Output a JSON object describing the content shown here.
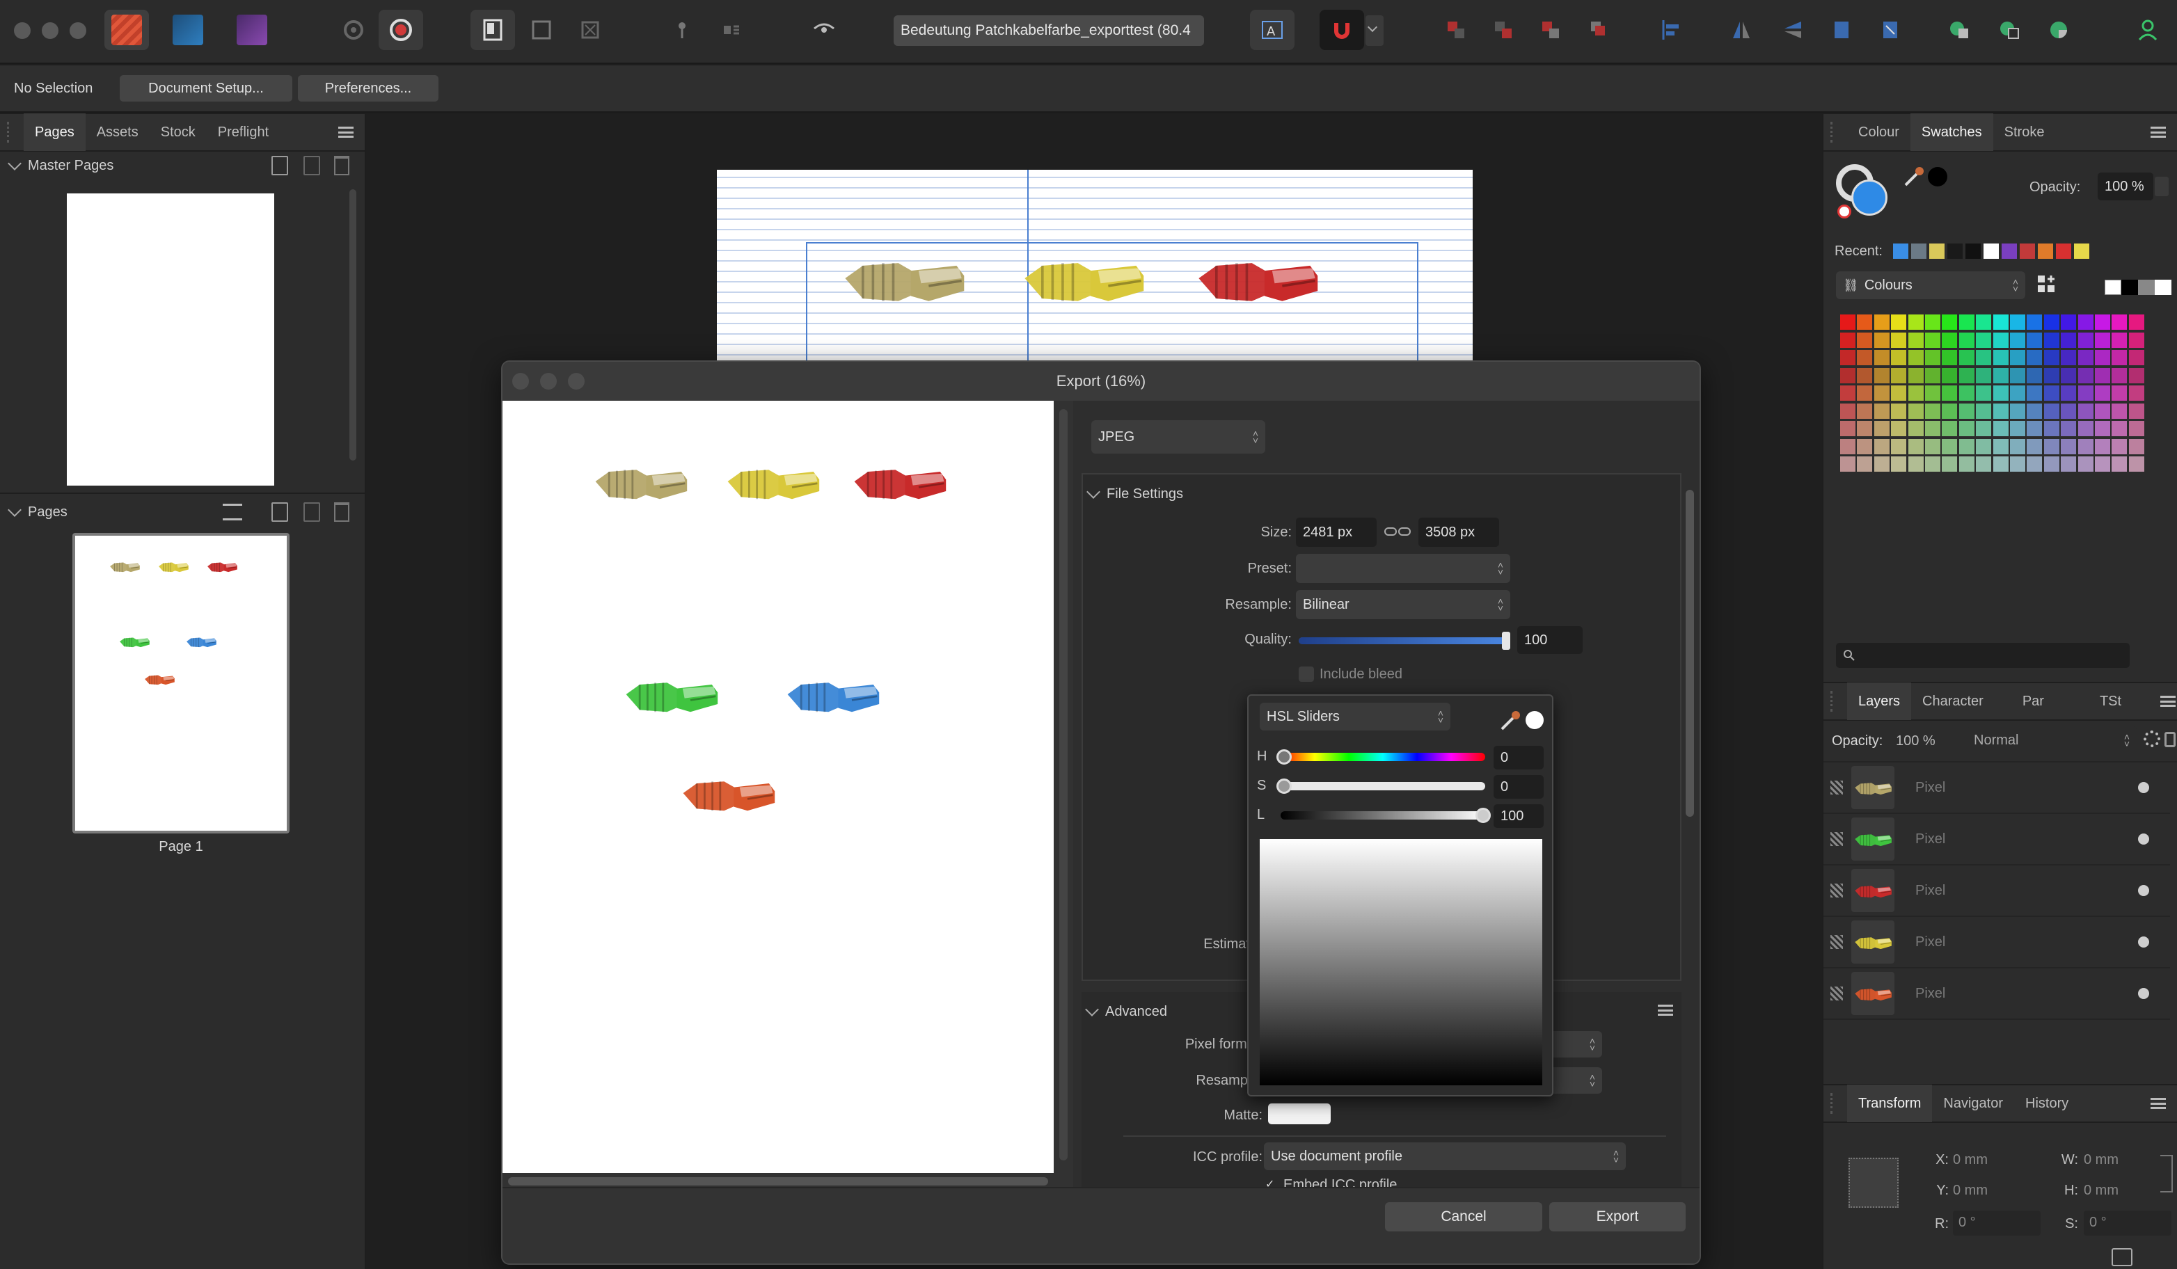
{
  "toolbar": {
    "document_title": "Bedeutung Patchkabelfarbe_exporttest (80.4"
  },
  "context_bar": {
    "selection_label": "No Selection",
    "document_setup": "Document Setup...",
    "preferences": "Preferences..."
  },
  "left_panel": {
    "tabs": [
      "Pages",
      "Assets",
      "Stock",
      "Preflight"
    ],
    "master_pages_title": "Master Pages",
    "pages_title": "Pages",
    "page_label": "Page 1"
  },
  "export_dialog": {
    "title": "Export (16%)",
    "format": "JPEG",
    "file_settings_title": "File Settings",
    "size_label": "Size:",
    "width": "2481 px",
    "height": "3508 px",
    "preset_label": "Preset:",
    "resample_label": "Resample:",
    "resample_value": "Bilinear",
    "quality_label": "Quality:",
    "quality_value": "100",
    "quality_fraction": 1.0,
    "include_bleed": "Include bleed",
    "estimated_label": "Estimated File",
    "advanced_title": "Advanced",
    "pixel_format_label": "Pixel format:",
    "adv_resample_label": "Resample:",
    "matte_label": "Matte:",
    "icc_label": "ICC profile:",
    "icc_value": "Use document profile",
    "embed_icc": "Embed ICC profile",
    "cancel": "Cancel",
    "export": "Export"
  },
  "color_picker": {
    "mode": "HSL Sliders",
    "h_label": "H",
    "h_value": "0",
    "s_label": "S",
    "s_value": "0",
    "l_label": "L",
    "l_value": "100"
  },
  "right_panel": {
    "colour_tabs": [
      "Colour",
      "Swatches",
      "Stroke"
    ],
    "opacity_label": "Opacity:",
    "opacity_value": "100 %",
    "recent_label": "Recent:",
    "palette": "Colours",
    "recent_colors": [
      "#3a8ee6",
      "#6b7a86",
      "#d9c85a",
      "#1a1a1a",
      "#111111",
      "#ffffff",
      "#7a3fbf",
      "#c23a3a",
      "#e07b2a",
      "#d83030",
      "#e6d84a"
    ],
    "layers_tabs": [
      "Layers",
      "Character",
      "Par",
      "TSt"
    ],
    "layers_opacity_label": "Opacity:",
    "layers_opacity_value": "100 %",
    "blend_mode": "Normal",
    "layers": [
      {
        "name": "Pixel",
        "color": "#b5a76a"
      },
      {
        "name": "Pixel",
        "color": "#3fc43f"
      },
      {
        "name": "Pixel",
        "color": "#c82a2a"
      },
      {
        "name": "Pixel",
        "color": "#d9c83a"
      },
      {
        "name": "Pixel",
        "color": "#d8552a"
      }
    ],
    "transform_tabs": [
      "Transform",
      "Navigator",
      "History"
    ],
    "x_label": "X:",
    "x_value": "0 mm",
    "y_label": "Y:",
    "y_value": "0 mm",
    "w_label": "W:",
    "w_value": "0 mm",
    "h_label": "H:",
    "h_value": "0 mm",
    "r_label": "R:",
    "r_value": "0 °",
    "s_label": "S:",
    "s_value": "0 °"
  },
  "connectors": [
    {
      "color": "#b5a76a"
    },
    {
      "color": "#d9c83a"
    },
    {
      "color": "#c82a2a"
    },
    {
      "color": "#3fc43f"
    },
    {
      "color": "#3a86d6"
    },
    {
      "color": "#d8552a"
    }
  ]
}
